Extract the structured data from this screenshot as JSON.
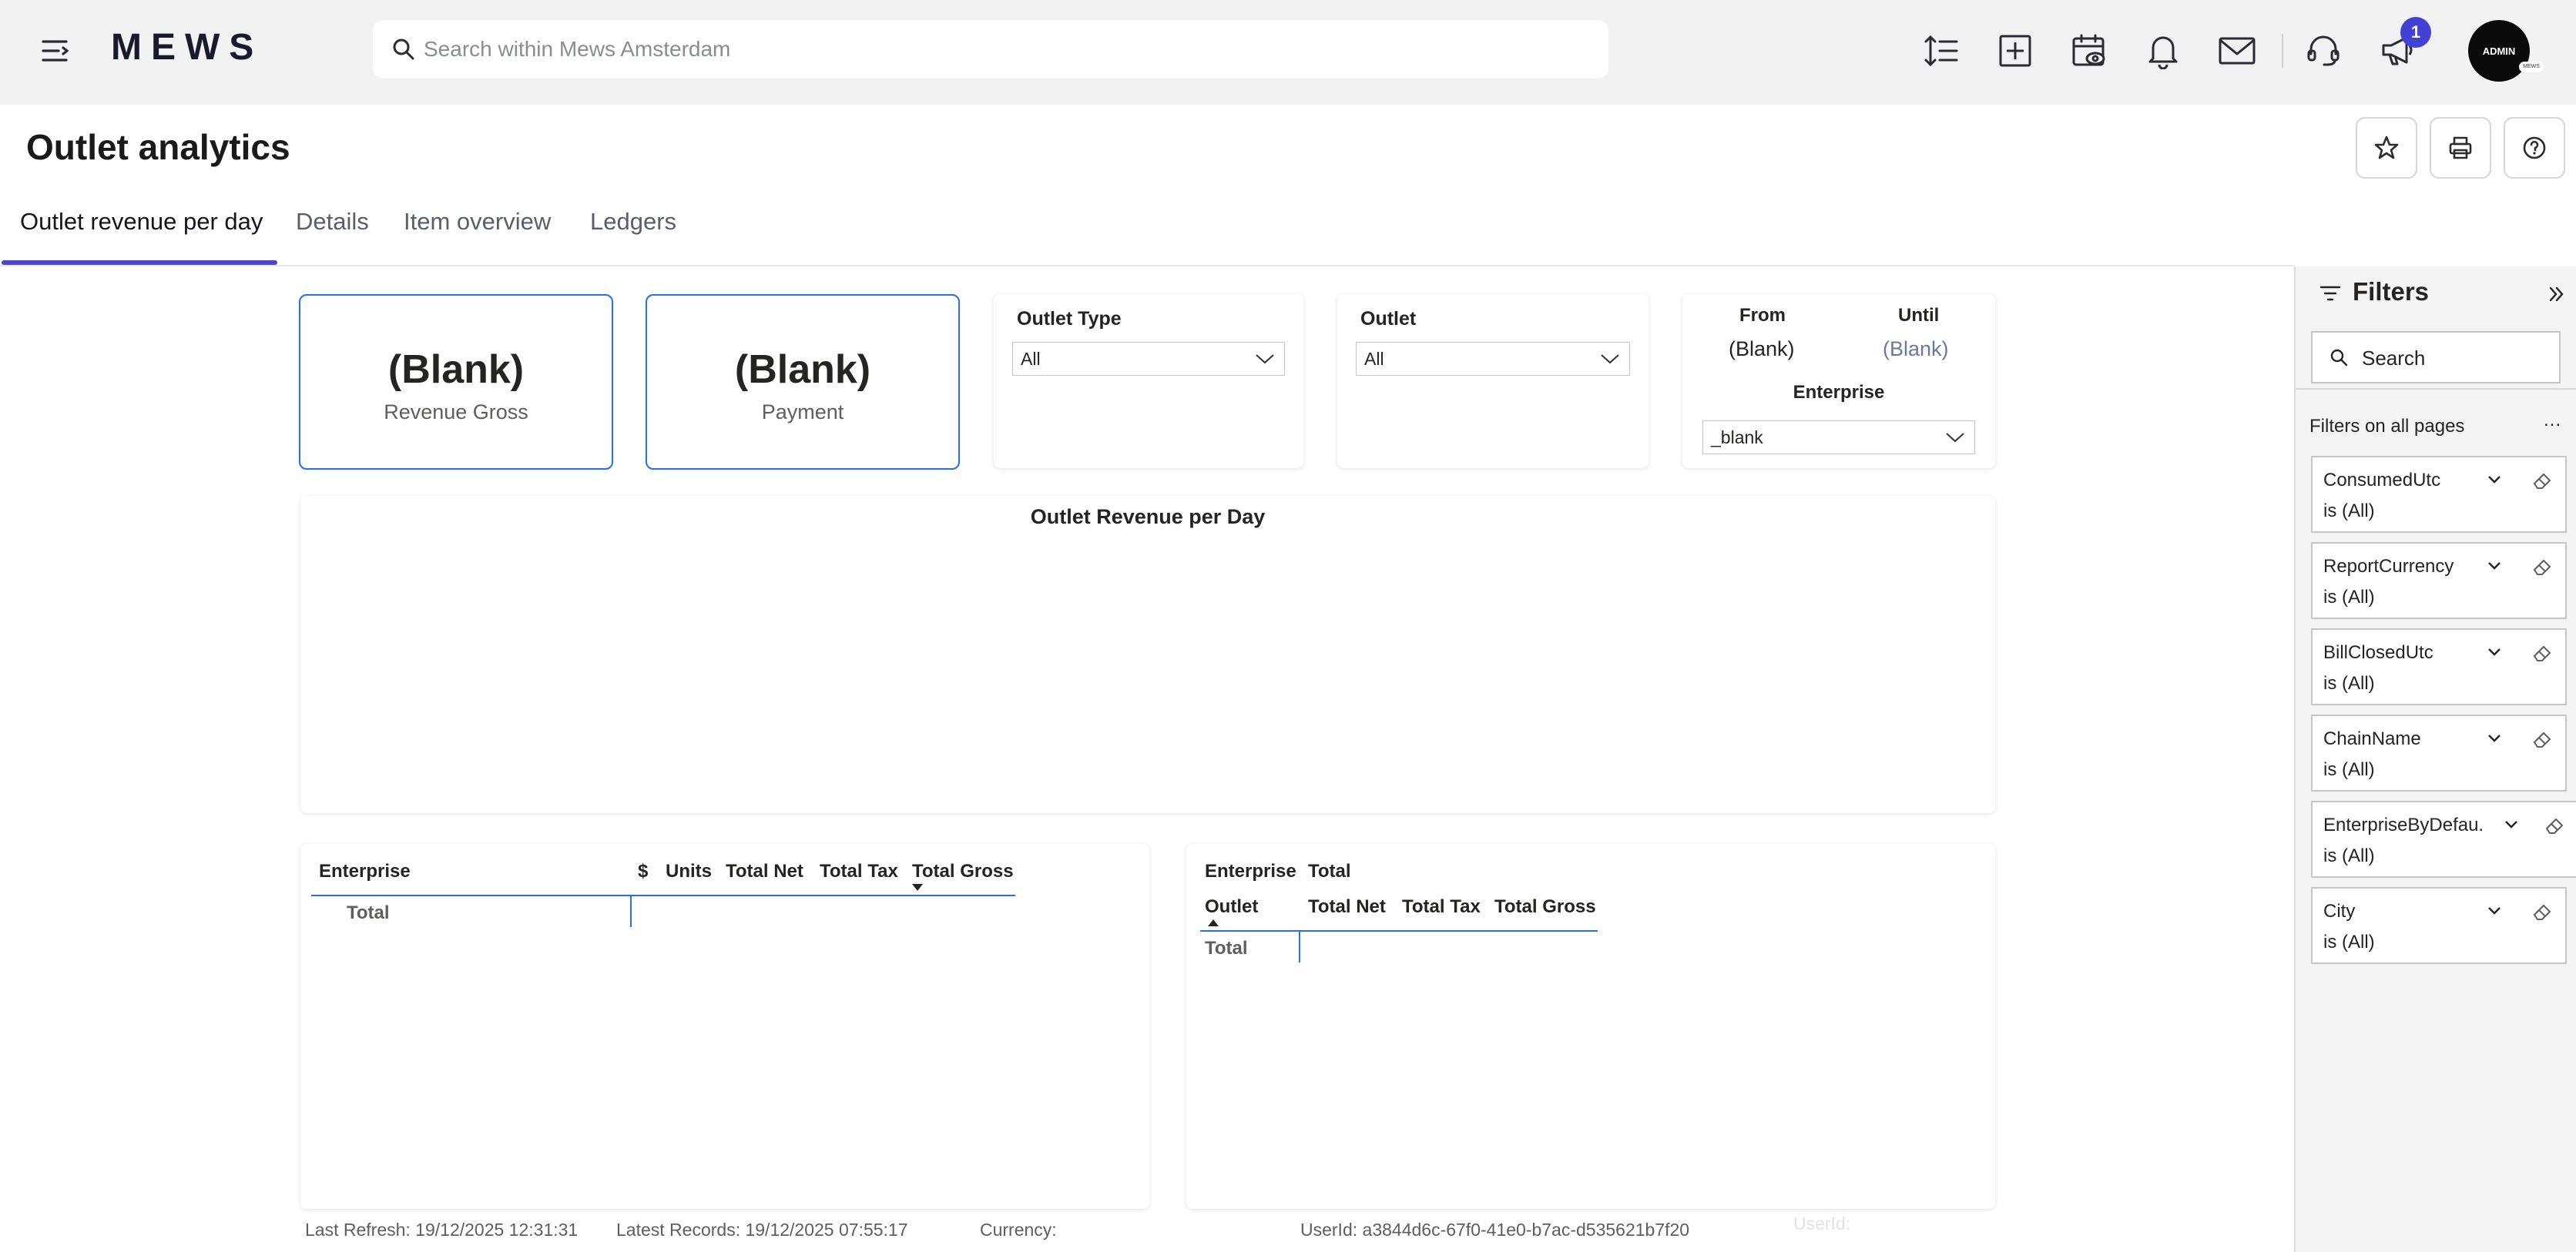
{
  "app": {
    "logo": "MEWS",
    "search_placeholder": "Search within Mews Amsterdam",
    "notifications_count": "1",
    "avatar_label": "ADMIN",
    "avatar_sub": "MEWS"
  },
  "page": {
    "title": "Outlet analytics",
    "tabs": [
      {
        "label": "Outlet revenue per day",
        "active": true
      },
      {
        "label": "Details",
        "active": false
      },
      {
        "label": "Item overview",
        "active": false
      },
      {
        "label": "Ledgers",
        "active": false
      }
    ]
  },
  "report": {
    "kpis": [
      {
        "value": "(Blank)",
        "label": "Revenue Gross"
      },
      {
        "value": "(Blank)",
        "label": "Payment"
      }
    ],
    "slicers": {
      "outlet_type": {
        "title": "Outlet Type",
        "value": "All"
      },
      "outlet": {
        "title": "Outlet",
        "value": "All"
      },
      "date": {
        "from_label": "From",
        "until_label": "Until",
        "from_value": "(Blank)",
        "until_value": "(Blank)",
        "enterprise_label": "Enterprise",
        "enterprise_value": "_blank"
      }
    },
    "chart_title": "Outlet Revenue per Day",
    "table1": {
      "headers": [
        "Enterprise",
        "$",
        "Units",
        "Total Net",
        "Total Tax",
        "Total Gross"
      ],
      "total_label": "Total"
    },
    "table2": {
      "top_headers": [
        "Enterprise",
        "Total"
      ],
      "headers": [
        "Outlet",
        "Total Net",
        "Total Tax",
        "Total Gross"
      ],
      "total_label": "Total"
    },
    "footer": {
      "last_refresh": "Last Refresh: 19/12/2025 12:31:31",
      "latest_records": "Latest Records: 19/12/2025 07:55:17",
      "currency": "Currency:",
      "user_id": "UserId: a3844d6c-67f0-41e0-b7ac-d535621b7f20",
      "user_id_ghost": "UserId:"
    }
  },
  "filters": {
    "title": "Filters",
    "search_placeholder": "Search",
    "section": "Filters on all pages",
    "items": [
      {
        "name": "ConsumedUtc",
        "value": "is (All)"
      },
      {
        "name": "ReportCurrency",
        "value": "is (All)"
      },
      {
        "name": "BillClosedUtc",
        "value": "is (All)"
      },
      {
        "name": "ChainName",
        "value": "is (All)"
      },
      {
        "name": "EnterpriseByDefau...",
        "value": "is (All)"
      },
      {
        "name": "City",
        "value": "is (All)"
      }
    ]
  },
  "colors": {
    "accent": "#4b45d1",
    "pbi_blue": "#2d6ee0",
    "badge": "#4340d6"
  }
}
